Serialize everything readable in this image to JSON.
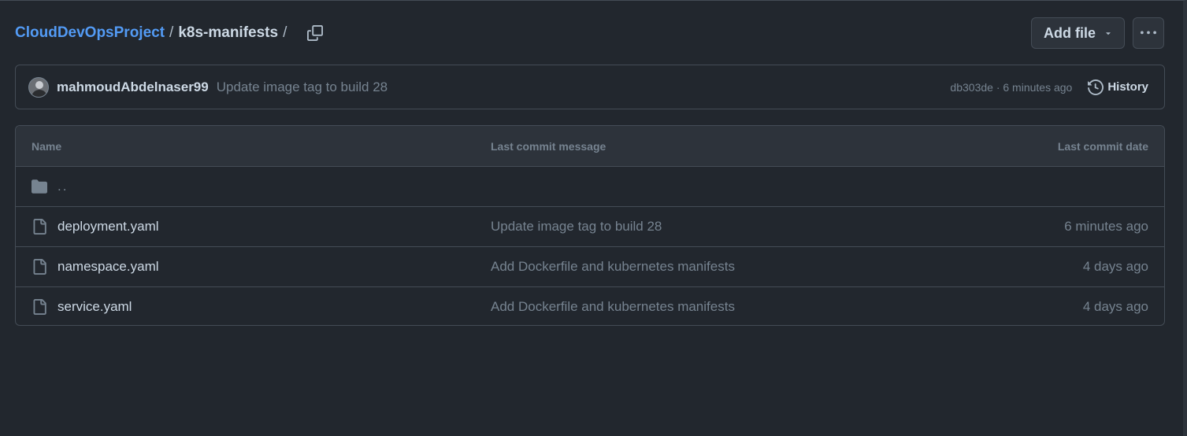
{
  "breadcrumb": {
    "repo": "CloudDevOpsProject",
    "separator": "/",
    "folder": "k8s-manifests",
    "trailing_separator": "/"
  },
  "header": {
    "add_file_label": "Add file",
    "more_label": "More options"
  },
  "commit": {
    "author": "mahmoudAbdelnaser99",
    "message": "Update image tag to build 28",
    "meta": "db303de · 6 minutes ago",
    "history_label": "History"
  },
  "table": {
    "columns": {
      "name": "Name",
      "message": "Last commit message",
      "date": "Last commit date"
    },
    "parent": "..",
    "rows": [
      {
        "name": "deployment.yaml",
        "message": "Update image tag to build 28",
        "date": "6 minutes ago",
        "icon": "file-icon"
      },
      {
        "name": "namespace.yaml",
        "message": "Add Dockerfile and kubernetes manifests",
        "date": "4 days ago",
        "icon": "file-icon"
      },
      {
        "name": "service.yaml",
        "message": "Add Dockerfile and kubernetes manifests",
        "date": "4 days ago",
        "icon": "file-icon"
      }
    ]
  },
  "colors": {
    "background": "#22272e",
    "link": "#539bf5",
    "text": "#cdd9e5",
    "muted": "#768390",
    "border": "#444c56"
  }
}
